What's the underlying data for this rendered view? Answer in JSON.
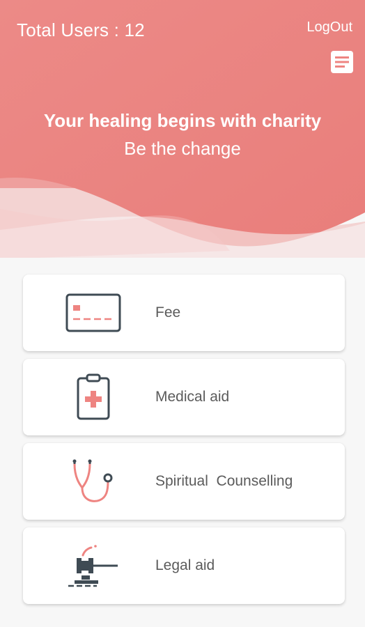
{
  "header": {
    "total_users": "Total Users : 12",
    "logout_label": "LogOut",
    "doc_icon": "document-list-icon",
    "tagline": "Your healing begins with charity",
    "subline": "Be the change"
  },
  "colors": {
    "accent": "#ee8481",
    "accent_dark": "#e97f7c",
    "icon_dark": "#3f4b54",
    "background": "#f7f7f7"
  },
  "services": [
    {
      "label": "Fee",
      "icon": "credit-card-icon"
    },
    {
      "label": "Medical aid",
      "icon": "medical-clipboard-icon"
    },
    {
      "label": "Spiritual  Counselling",
      "icon": "stethoscope-icon"
    },
    {
      "label": "Legal aid",
      "icon": "gavel-icon"
    }
  ]
}
